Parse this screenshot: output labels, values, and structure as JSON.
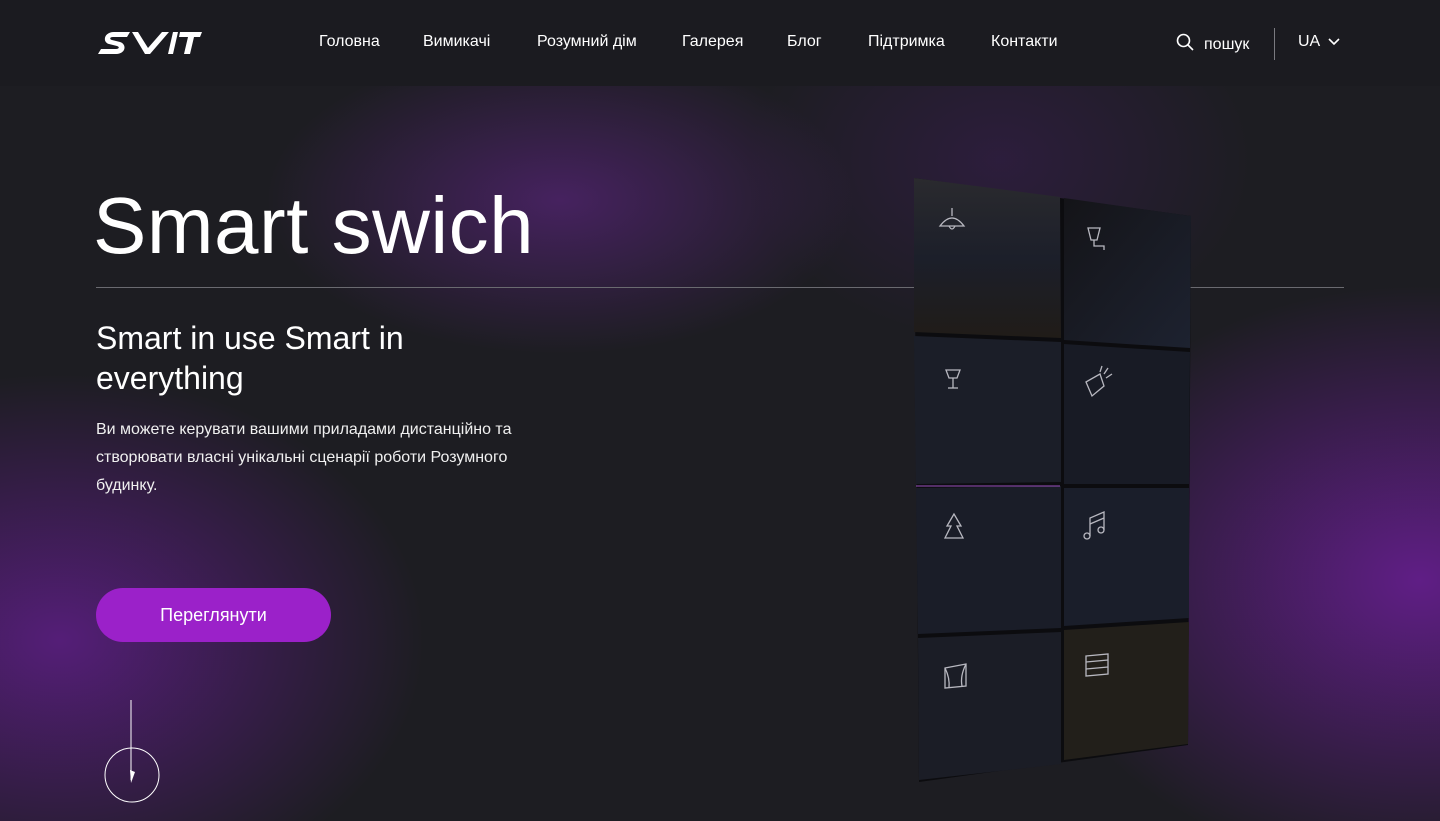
{
  "header": {
    "brand": "SVIT",
    "nav": [
      {
        "label": "Головна"
      },
      {
        "label": "Вимикачі"
      },
      {
        "label": "Розумний дім"
      },
      {
        "label": "Галерея"
      },
      {
        "label": "Блог"
      },
      {
        "label": "Підтримка"
      },
      {
        "label": "Контакти"
      }
    ],
    "search_label": "пошук",
    "language": "UA"
  },
  "hero": {
    "title": "Smart swich",
    "subtitle": "Smart in use Smart in everything",
    "description": "Ви можете керувати вашими приладами дистанційно та створювати власні унікальні сценарії роботи Розумного будинку.",
    "cta_label": "Переглянути"
  },
  "colors": {
    "background": "#1d1d22",
    "accent": "#9b21c9",
    "text": "#ffffff"
  },
  "panel_icons": [
    "ceiling-lamp-icon",
    "wall-sconce-icon",
    "floor-lamp-icon",
    "spotlight-icon",
    "tree-icon",
    "music-note-icon",
    "curtains-icon",
    "blinds-icon"
  ]
}
